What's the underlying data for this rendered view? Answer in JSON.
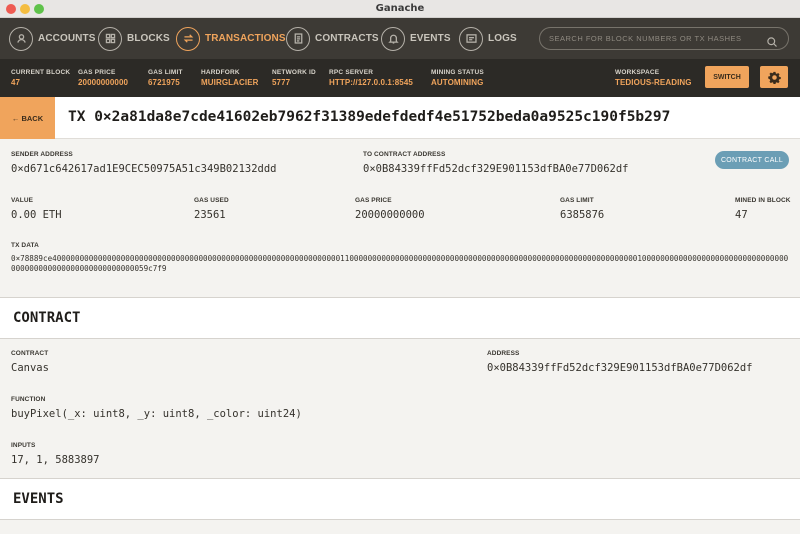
{
  "window": {
    "title": "Ganache"
  },
  "nav": {
    "items": [
      {
        "label": "ACCOUNTS",
        "icon": "account-icon"
      },
      {
        "label": "BLOCKS",
        "icon": "blocks-icon"
      },
      {
        "label": "TRANSACTIONS",
        "icon": "transactions-icon",
        "active": true
      },
      {
        "label": "CONTRACTS",
        "icon": "contracts-icon"
      },
      {
        "label": "EVENTS",
        "icon": "bell-icon"
      },
      {
        "label": "LOGS",
        "icon": "logs-icon"
      }
    ],
    "search_placeholder": "SEARCH FOR BLOCK NUMBERS OR TX HASHES"
  },
  "status": {
    "current_block": {
      "label": "CURRENT BLOCK",
      "value": "47"
    },
    "gas_price": {
      "label": "GAS PRICE",
      "value": "20000000000"
    },
    "gas_limit": {
      "label": "GAS LIMIT",
      "value": "6721975"
    },
    "hardfork": {
      "label": "HARDFORK",
      "value": "MUIRGLACIER"
    },
    "network_id": {
      "label": "NETWORK ID",
      "value": "5777"
    },
    "rpc_server": {
      "label": "RPC SERVER",
      "value": "HTTP://127.0.0.1:8545"
    },
    "mining_status": {
      "label": "MINING STATUS",
      "value": "AUTOMINING"
    },
    "workspace": {
      "label": "WORKSPACE",
      "value": "TEDIOUS-READING"
    },
    "switch_label": "SWITCH"
  },
  "tx": {
    "back_label": "← BACK",
    "hash": "TX 0×2a81da8e7cde41602eb7962f31389edefdedf4e51752beda0a9525c190f5b297",
    "sender_label": "SENDER ADDRESS",
    "sender": "0×d671c642617ad1E9CEC50975A51c349B02132ddd",
    "to_label": "TO CONTRACT ADDRESS",
    "to": "0×0B84339ffFd52dcf329E901153dfBA0e77D062df",
    "badge": "CONTRACT CALL",
    "value_label": "VALUE",
    "value": "0.00 ETH",
    "gas_used_label": "GAS USED",
    "gas_used": "23561",
    "gas_price_label": "GAS PRICE",
    "gas_price": "20000000000",
    "gas_limit_label": "GAS LIMIT",
    "gas_limit": "6385876",
    "mined_label": "MINED IN BLOCK",
    "mined": "47",
    "data_label": "TX DATA",
    "data": "0×78889ce40000000000000000000000000000000000000000000000000000000000000011000000000000000000000000000000000000000000000000000000000000000100000000000000000000000000000000000000000000000000000000000059c7f9"
  },
  "contract": {
    "section_title": "CONTRACT",
    "contract_label": "CONTRACT",
    "contract": "Canvas",
    "address_label": "ADDRESS",
    "address": "0×0B84339ffFd52dcf329E901153dfBA0e77D062df",
    "function_label": "FUNCTION",
    "function": "buyPixel(_x: uint8, _y: uint8, _color: uint24)",
    "inputs_label": "INPUTS",
    "inputs": "17, 1, 5883897"
  },
  "events": {
    "section_title": "EVENTS"
  },
  "colors": {
    "accent": "#f0a45c",
    "nav_bg": "#3d3a35",
    "status_bg": "#2c2a26",
    "badge": "#6b9eb5"
  }
}
